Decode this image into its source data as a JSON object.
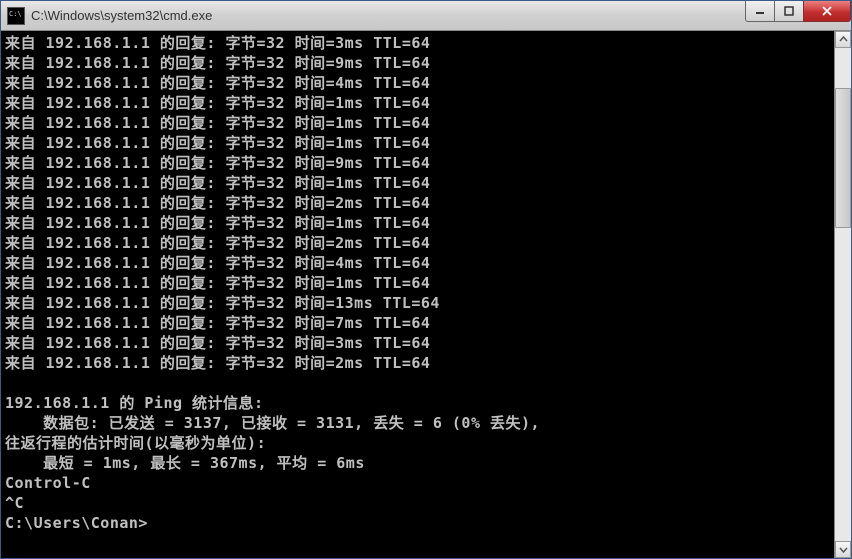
{
  "window": {
    "title": "C:\\Windows\\system32\\cmd.exe"
  },
  "ping": {
    "replies": [
      {
        "ip": "192.168.1.1",
        "bytes": 32,
        "time": "3ms",
        "ttl": 64
      },
      {
        "ip": "192.168.1.1",
        "bytes": 32,
        "time": "9ms",
        "ttl": 64
      },
      {
        "ip": "192.168.1.1",
        "bytes": 32,
        "time": "4ms",
        "ttl": 64
      },
      {
        "ip": "192.168.1.1",
        "bytes": 32,
        "time": "1ms",
        "ttl": 64
      },
      {
        "ip": "192.168.1.1",
        "bytes": 32,
        "time": "1ms",
        "ttl": 64
      },
      {
        "ip": "192.168.1.1",
        "bytes": 32,
        "time": "1ms",
        "ttl": 64
      },
      {
        "ip": "192.168.1.1",
        "bytes": 32,
        "time": "9ms",
        "ttl": 64
      },
      {
        "ip": "192.168.1.1",
        "bytes": 32,
        "time": "1ms",
        "ttl": 64
      },
      {
        "ip": "192.168.1.1",
        "bytes": 32,
        "time": "2ms",
        "ttl": 64
      },
      {
        "ip": "192.168.1.1",
        "bytes": 32,
        "time": "1ms",
        "ttl": 64
      },
      {
        "ip": "192.168.1.1",
        "bytes": 32,
        "time": "2ms",
        "ttl": 64
      },
      {
        "ip": "192.168.1.1",
        "bytes": 32,
        "time": "4ms",
        "ttl": 64
      },
      {
        "ip": "192.168.1.1",
        "bytes": 32,
        "time": "1ms",
        "ttl": 64
      },
      {
        "ip": "192.168.1.1",
        "bytes": 32,
        "time": "13ms",
        "ttl": 64
      },
      {
        "ip": "192.168.1.1",
        "bytes": 32,
        "time": "7ms",
        "ttl": 64
      },
      {
        "ip": "192.168.1.1",
        "bytes": 32,
        "time": "3ms",
        "ttl": 64
      },
      {
        "ip": "192.168.1.1",
        "bytes": 32,
        "time": "2ms",
        "ttl": 64
      }
    ],
    "labels": {
      "from": "来自",
      "reply": "的回复:",
      "bytes": "字节",
      "time": "时间",
      "ttl": "TTL"
    },
    "stats": {
      "header": "192.168.1.1 的 Ping 统计信息:",
      "packets": "    数据包: 已发送 = 3137, 已接收 = 3131, 丢失 = 6 (0% 丢失),",
      "rtt_header": "往返行程的估计时间(以毫秒为单位):",
      "rtt": "    最短 = 1ms, 最长 = 367ms, 平均 = 6ms"
    },
    "control_c": "Control-C",
    "caret_c": "^C"
  },
  "prompt": "C:\\Users\\Conan>"
}
